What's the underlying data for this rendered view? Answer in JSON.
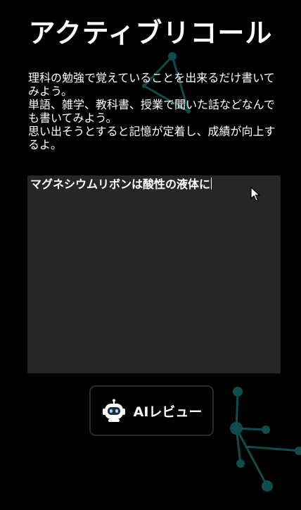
{
  "header": {
    "title": "アクティブリコール"
  },
  "instructions": {
    "lines": [
      "理科の勉強で覚えていることを出来るだけ書いてみよう。",
      "単語、雑学、教科書、授業で聞いた話などなんでも書いてみよう。",
      "思い出そうとすると記憶が定着し、成績が向上するよ。"
    ]
  },
  "editor": {
    "value": "マグネシウムリボンは酸性の液体に"
  },
  "ai_review_button": {
    "label": "AIレビュー",
    "icon": "robot-icon"
  },
  "colors": {
    "background": "#000000",
    "editor_background": "#262626",
    "decoration": "#0f4d4d",
    "text": "#ffffff"
  }
}
